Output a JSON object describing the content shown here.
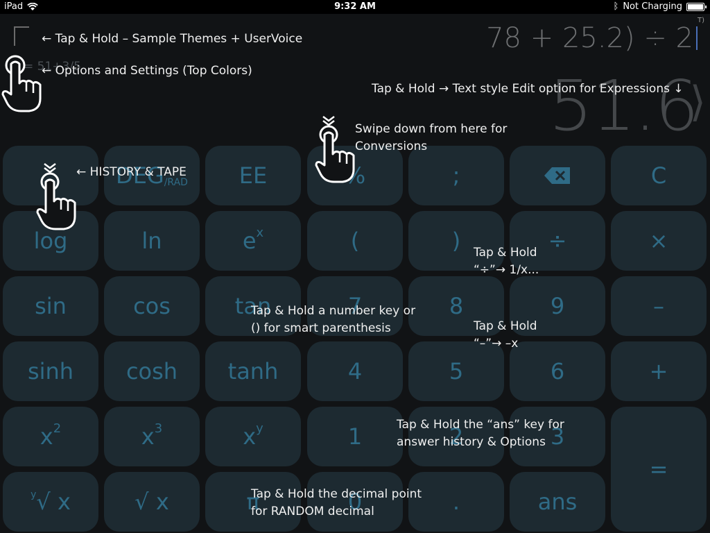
{
  "status_bar": {
    "device": "iPad",
    "time": "9:32 AM",
    "battery_status": "Not Charging",
    "battery_level": 1.0
  },
  "display": {
    "expression": "78 + 25.2) ÷ 2",
    "result": "51.6",
    "mode": "T)",
    "previous": "= 51+3/5"
  },
  "keys": {
    "deg": "DEG",
    "rad": "/RAD",
    "ee": "EE",
    "percent": "%",
    "semicolon": ";",
    "clear": "C",
    "log": "log",
    "ln": "ln",
    "e": "e",
    "e_sup": "x",
    "open_paren": "(",
    "close_paren": ")",
    "divide": "÷",
    "multiply": "×",
    "sin": "sin",
    "cos": "cos",
    "tan": "tan",
    "seven": "7",
    "eight": "8",
    "nine": "9",
    "minus": "–",
    "sinh": "sinh",
    "cosh": "cosh",
    "tanh": "tanh",
    "four": "4",
    "five": "5",
    "six": "6",
    "plus": "+",
    "x2": "x",
    "x2_sup": "2",
    "x3": "x",
    "x3_sup": "3",
    "xy": "x",
    "xy_sup": "y",
    "one": "1",
    "two": "2",
    "three": "3",
    "equals": "=",
    "yroot_pre": "y",
    "yroot": "√ x",
    "sqrt": "√ x",
    "pi": "π",
    "zero": "0",
    "decimal": ".",
    "ans": "ans"
  },
  "hints": {
    "themes": "← Tap & Hold – Sample Themes + UserVoice",
    "options": "← Options and Settings (Top Colors)",
    "text_edit": "Tap & Hold → Text style Edit option for Expressions ↓",
    "conversions_1": "Swipe down from here for",
    "conversions_2": "Conversions",
    "history": "← HISTORY & TAPE",
    "divide_1": "Tap & Hold",
    "divide_2": "“÷”→ 1/x...",
    "number_1": "Tap & Hold a number key or",
    "number_2": "() for smart parenthesis",
    "minus_1": "Tap & Hold",
    "minus_2": "“–”→ –x",
    "ans_1": "Tap & Hold the “ans” key for",
    "ans_2": "answer history & Options",
    "decimal_1": "Tap & Hold the decimal point",
    "decimal_2": "for RANDOM decimal"
  },
  "colors": {
    "background": "#111315",
    "key": "#1d2a31",
    "key_text": "#2f6b86",
    "hint_text": "#f0f0f0"
  }
}
